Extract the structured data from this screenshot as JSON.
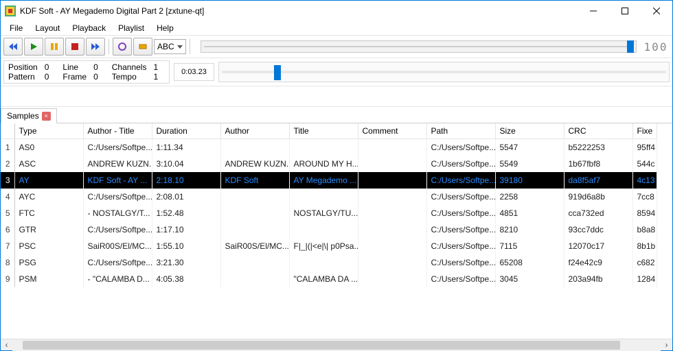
{
  "window": {
    "title": "KDF Soft - AY Megademo Digital Part 2 [zxtune-qt]"
  },
  "menu": {
    "file": "File",
    "layout": "Layout",
    "playback": "Playback",
    "playlist": "Playlist",
    "help": "Help"
  },
  "toolbar": {
    "sort_mode": "ABC",
    "seg_display": "100"
  },
  "status": {
    "position_label": "Position",
    "position_val": "0",
    "line_label": "Line",
    "line_val": "0",
    "channels_label": "Channels",
    "channels_val": "1",
    "pattern_label": "Pattern",
    "pattern_val": "0",
    "frame_label": "Frame",
    "frame_val": "0",
    "tempo_label": "Tempo",
    "tempo_val": "1",
    "time": "0:03.23"
  },
  "tab": {
    "label": "Samples"
  },
  "columns": {
    "type": "Type",
    "author_title": "Author - Title",
    "duration": "Duration",
    "author": "Author",
    "title": "Title",
    "comment": "Comment",
    "path": "Path",
    "size": "Size",
    "crc": "CRC",
    "fixed": "Fixe"
  },
  "rows": [
    {
      "n": "1",
      "type": "AS0",
      "at": "C:/Users/Softpe...",
      "dur": "1:11.34",
      "author": "",
      "title": "",
      "comment": "",
      "path": "C:/Users/Softpe...",
      "size": "5547",
      "crc": "b5222253",
      "fixed": "95ff4"
    },
    {
      "n": "2",
      "type": "ASC",
      "at": "ANDREW KUZN...",
      "dur": "3:10.04",
      "author": "ANDREW KUZN...",
      "title": "AROUND MY H...",
      "comment": "",
      "path": "C:/Users/Softpe...",
      "size": "5549",
      "crc": "1b67fbf8",
      "fixed": "544c"
    },
    {
      "n": "3",
      "type": "AY",
      "at": "KDF Soft - AY ...",
      "dur": "2:18.10",
      "author": "KDF Soft",
      "title": "AY Megademo ...",
      "comment": "",
      "path": "C:/Users/Softpe...",
      "size": "39180",
      "crc": "da8f5af7",
      "fixed": "4c13",
      "selected": true
    },
    {
      "n": "4",
      "type": "AYC",
      "at": "C:/Users/Softpe...",
      "dur": "2:08.01",
      "author": "",
      "title": "",
      "comment": "",
      "path": "C:/Users/Softpe...",
      "size": "2258",
      "crc": "919d6a8b",
      "fixed": "7cc8"
    },
    {
      "n": "5",
      "type": "FTC",
      "at": "  - NOSTALGY/T...",
      "dur": "1:52.48",
      "author": "",
      "title": "NOSTALGY/TU...",
      "comment": "",
      "path": "C:/Users/Softpe...",
      "size": "4851",
      "crc": "cca732ed",
      "fixed": "8594"
    },
    {
      "n": "6",
      "type": "GTR",
      "at": "C:/Users/Softpe...",
      "dur": "1:17.10",
      "author": "",
      "title": "",
      "comment": "",
      "path": "C:/Users/Softpe...",
      "size": "8210",
      "crc": "93cc7ddc",
      "fixed": "b8a8"
    },
    {
      "n": "7",
      "type": "PSC",
      "at": "SaiR00S/El/MC...",
      "dur": "1:55.10",
      "author": "SaiR00S/El/MC...",
      "title": "F|_|(|<e|\\| p0Psa...",
      "comment": "",
      "path": "C:/Users/Softpe...",
      "size": "7115",
      "crc": "12070c17",
      "fixed": "8b1b"
    },
    {
      "n": "8",
      "type": "PSG",
      "at": "C:/Users/Softpe...",
      "dur": "3:21.30",
      "author": "",
      "title": "",
      "comment": "",
      "path": "C:/Users/Softpe...",
      "size": "65208",
      "crc": "f24e42c9",
      "fixed": "c682"
    },
    {
      "n": "9",
      "type": "PSM",
      "at": "  - \"CALAMBA D...",
      "dur": "4:05.38",
      "author": "",
      "title": "\"CALAMBA DA ...",
      "comment": "",
      "path": "C:/Users/Softpe...",
      "size": "3045",
      "crc": "203a94fb",
      "fixed": "1284"
    }
  ]
}
